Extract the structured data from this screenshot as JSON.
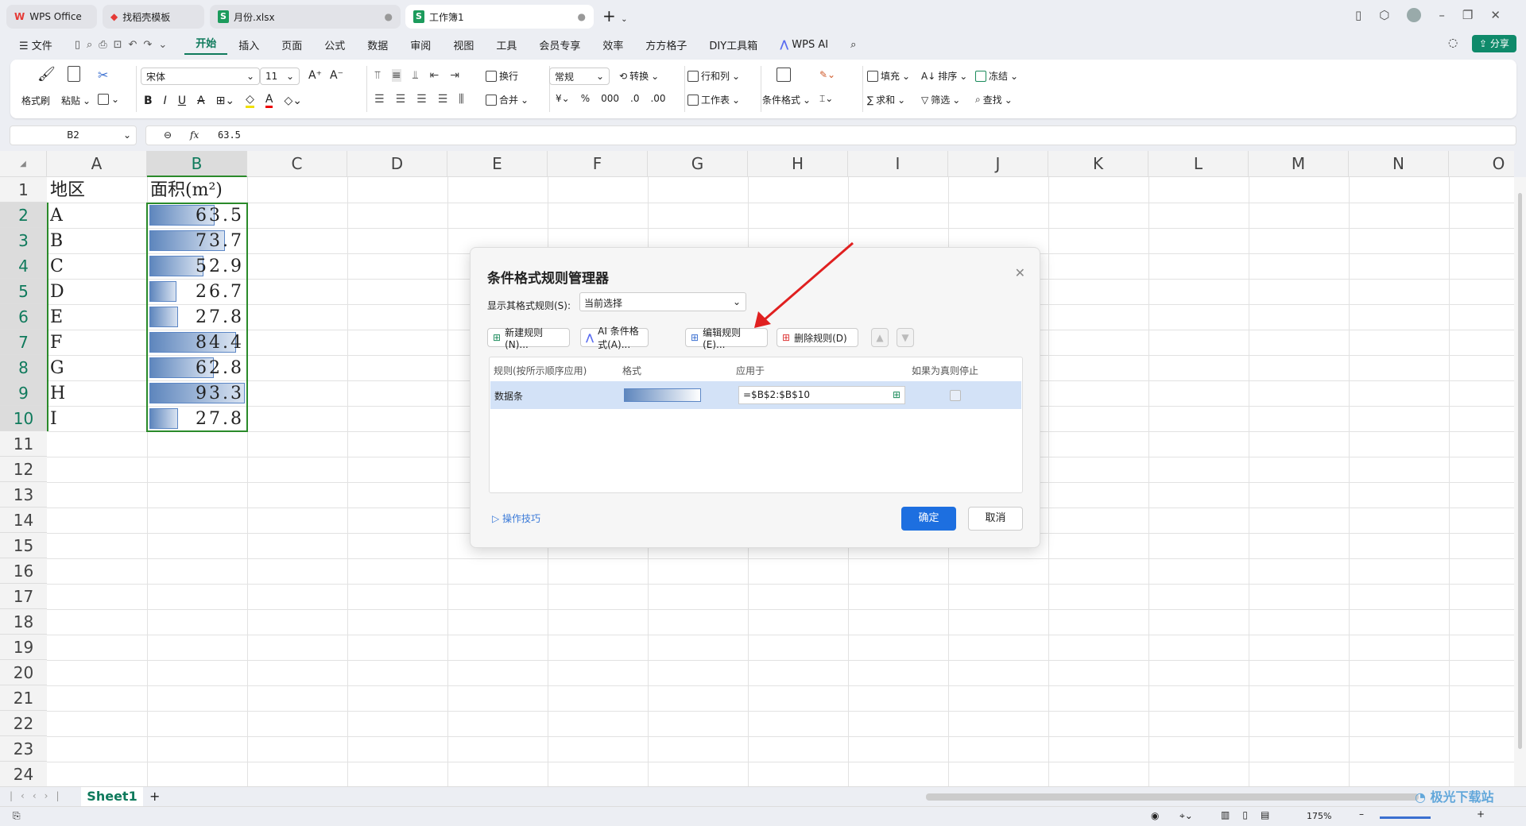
{
  "tabs": [
    {
      "label": "WPS Office"
    },
    {
      "label": "找稻壳模板"
    },
    {
      "label": "月份.xlsx"
    },
    {
      "label": "工作簿1"
    }
  ],
  "menu": {
    "file": "文件",
    "items": [
      "开始",
      "插入",
      "页面",
      "公式",
      "数据",
      "审阅",
      "视图",
      "工具",
      "会员专享",
      "效率",
      "方方格子",
      "DIY工具箱"
    ],
    "wps_ai": "WPS AI",
    "share": "分享"
  },
  "ribbon": {
    "format_painter": "格式刷",
    "paste": "粘贴",
    "font": "宋体",
    "size": "11",
    "wrap": "换行",
    "merge": "合并",
    "number_format": "常规",
    "convert": "转换",
    "rows_cols": "行和列",
    "worksheet": "工作表",
    "cond_format": "条件格式",
    "fill": "填充",
    "sort": "排序",
    "freeze": "冻结",
    "sum": "求和",
    "filter": "筛选",
    "find": "查找"
  },
  "formula_bar": {
    "cell_ref": "B2",
    "fx": "fx",
    "value": "63.5"
  },
  "columns": [
    "A",
    "B",
    "C",
    "D",
    "E",
    "F",
    "G",
    "H",
    "I",
    "J",
    "K",
    "L",
    "M",
    "N",
    "O"
  ],
  "rows": [
    "1",
    "2",
    "3",
    "4",
    "5",
    "6",
    "7",
    "8",
    "9",
    "10",
    "11",
    "12",
    "13",
    "14",
    "15",
    "16",
    "17",
    "18",
    "19",
    "20",
    "21",
    "22",
    "23",
    "24"
  ],
  "sheet": {
    "header_a": "地区",
    "header_b": "面积(m²)",
    "data": [
      {
        "region": "A",
        "area": "63.5",
        "value": 63.5
      },
      {
        "region": "B",
        "area": "73.7",
        "value": 73.7
      },
      {
        "region": "C",
        "area": "52.9",
        "value": 52.9
      },
      {
        "region": "D",
        "area": "26.7",
        "value": 26.7
      },
      {
        "region": "E",
        "area": "27.8",
        "value": 27.8
      },
      {
        "region": "F",
        "area": "84.4",
        "value": 84.4
      },
      {
        "region": "G",
        "area": "62.8",
        "value": 62.8
      },
      {
        "region": "H",
        "area": "93.3",
        "value": 93.3
      },
      {
        "region": "I",
        "area": "27.8",
        "value": 27.8
      }
    ]
  },
  "dialog": {
    "title": "条件格式规则管理器",
    "show_label": "显示其格式规则(S):",
    "show_value": "当前选择",
    "new_rule": "新建规则(N)...",
    "ai_rule": "AI 条件格式(A)...",
    "edit_rule": "编辑规则(E)...",
    "delete_rule": "删除规则(D)",
    "col_rule": "规则(按所示顺序应用)",
    "col_format": "格式",
    "col_apply": "应用于",
    "col_stop": "如果为真则停止",
    "rule_name": "数据条",
    "rule_range": "=$B$2:$B$10",
    "tips": "操作技巧",
    "ok": "确定",
    "cancel": "取消"
  },
  "bottom": {
    "sheet_tab": "Sheet1",
    "zoom": "175%"
  },
  "watermark": "极光下载站 www.xz7.com"
}
